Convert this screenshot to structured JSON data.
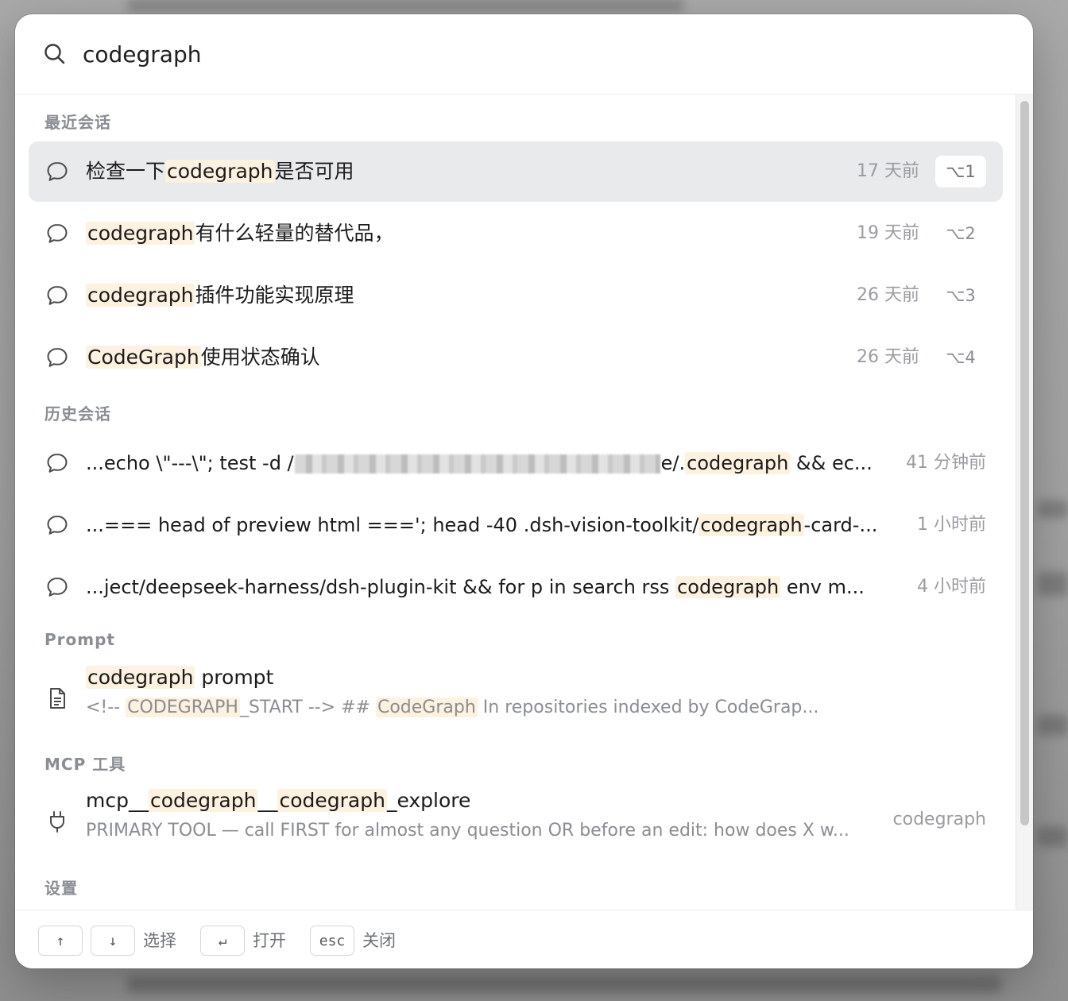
{
  "search": {
    "query": "codegraph"
  },
  "sections": {
    "recent": "最近会话",
    "history": "历史会话",
    "prompt": "Prompt",
    "mcp": "MCP 工具",
    "settings": "设置"
  },
  "recent": [
    {
      "pre": "检查一下",
      "hl": "codegraph",
      "post": "是否可用",
      "time": "17 天前",
      "shortcut": "⌥1"
    },
    {
      "pre": "",
      "hl": "codegraph",
      "post": "有什么轻量的替代品，",
      "time": "19 天前",
      "shortcut": "⌥2"
    },
    {
      "pre": "",
      "hl": "codegraph",
      "post": "插件功能实现原理",
      "time": "26 天前",
      "shortcut": "⌥3"
    },
    {
      "pre": "",
      "hl": "CodeGraph",
      "post": "使用状态确认",
      "time": "26 天前",
      "shortcut": "⌥4"
    }
  ],
  "history": [
    {
      "pre": "...echo \\\"---\\\"; test -d /",
      "mid": "e/.",
      "hl": "codegraph",
      "post": " && ec...",
      "time": "41 分钟前"
    },
    {
      "pre": "...=== head of preview html ===';  head -40 .dsh-vision-toolkit/",
      "hl": "codegraph",
      "post": "-card-...",
      "time": "1 小时前"
    },
    {
      "pre": "...ject/deepseek-harness/dsh-plugin-kit && for p in search rss ",
      "hl": "codegraph",
      "post": " env m...",
      "time": "4 小时前"
    }
  ],
  "prompt_item": {
    "title_hl": "codegraph",
    "title_post": " prompt",
    "sub_pre": "<!-- ",
    "sub_hl1": "CODEGRAPH",
    "sub_mid": "_START --> ## ",
    "sub_hl2": "CodeGraph",
    "sub_post": " In repositories indexed by CodeGrap..."
  },
  "mcp_item": {
    "t1": "mcp__",
    "t_hl1": "codegraph",
    "t2": "__",
    "t_hl2": "codegraph",
    "t3": "_explore",
    "sub": "PRIMARY TOOL — call FIRST for almost any question OR before an edit: how does X w...",
    "tag": "codegraph"
  },
  "footer": {
    "up": "↑",
    "down": "↓",
    "select": "选择",
    "enter": "↵",
    "open": "打开",
    "esc": "esc",
    "close": "关闭"
  },
  "icons": {
    "search": "search-icon",
    "chat": "chat-bubble-icon",
    "doc": "document-icon",
    "plug": "plug-icon"
  },
  "colors": {
    "highlight": "#fdf1df",
    "selected_row": "#e9eaec"
  }
}
